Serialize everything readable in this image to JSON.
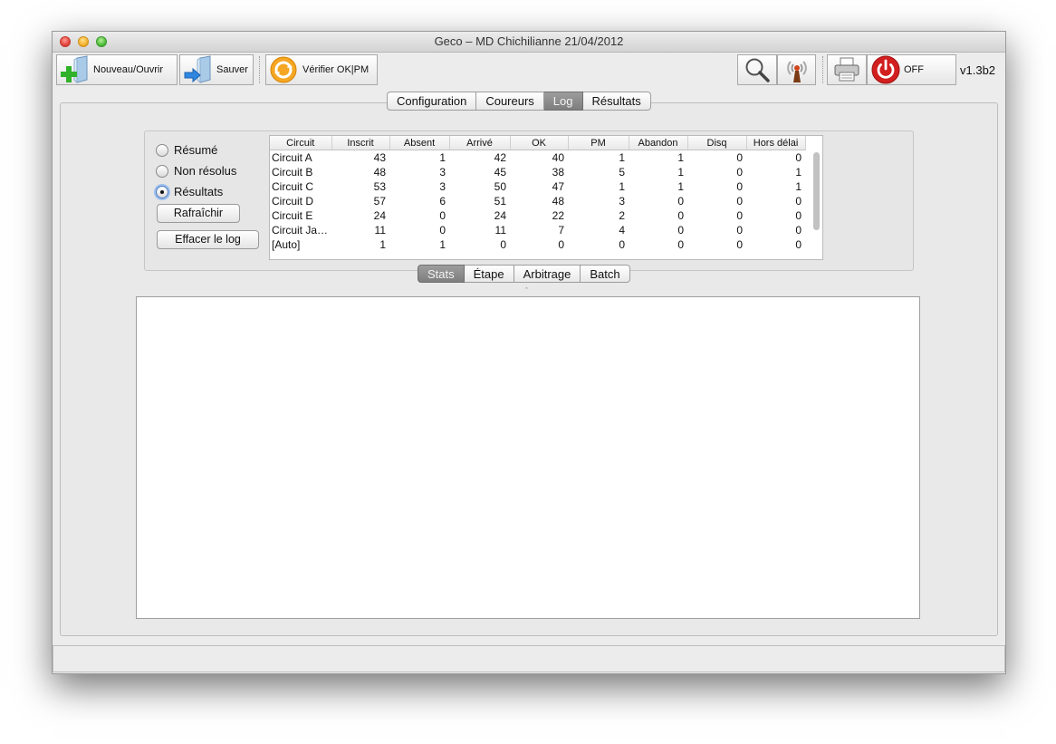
{
  "window": {
    "title": "Geco – MD Chichilianne 21/04/2012"
  },
  "toolbar": {
    "new_open_label": "Nouveau/Ouvrir",
    "save_label": "Sauver",
    "verify_label": "Vérifier OK|PM",
    "off_label": "OFF",
    "version": "v1.3b2"
  },
  "main_tabs": [
    "Configuration",
    "Coureurs",
    "Log",
    "Résultats"
  ],
  "main_tab_active": "Log",
  "options": {
    "radios": [
      {
        "label": "Résumé",
        "checked": false
      },
      {
        "label": "Non résolus",
        "checked": false
      },
      {
        "label": "Résultats",
        "checked": true
      }
    ],
    "refresh_label": "Rafraîchir",
    "clear_label": "Effacer le log"
  },
  "stats_table": {
    "headers": [
      "Circuit",
      "Inscrit",
      "Absent",
      "Arrivé",
      "OK",
      "PM",
      "Abandon",
      "Disq",
      "Hors délai"
    ],
    "rows": [
      [
        "Circuit A",
        "43",
        "1",
        "42",
        "40",
        "1",
        "1",
        "0",
        "0"
      ],
      [
        "Circuit B",
        "48",
        "3",
        "45",
        "38",
        "5",
        "1",
        "0",
        "1"
      ],
      [
        "Circuit C",
        "53",
        "3",
        "50",
        "47",
        "1",
        "1",
        "0",
        "1"
      ],
      [
        "Circuit D",
        "57",
        "6",
        "51",
        "48",
        "3",
        "0",
        "0",
        "0"
      ],
      [
        "Circuit E",
        "24",
        "0",
        "24",
        "22",
        "2",
        "0",
        "0",
        "0"
      ],
      [
        "Circuit Ja…",
        "11",
        "0",
        "11",
        "7",
        "4",
        "0",
        "0",
        "0"
      ],
      [
        "[Auto]",
        "1",
        "1",
        "0",
        "0",
        "0",
        "0",
        "0",
        "0"
      ]
    ]
  },
  "sub_tabs": [
    "Stats",
    "Étape",
    "Arbitrage",
    "Batch"
  ],
  "sub_tab_active": "Stats"
}
